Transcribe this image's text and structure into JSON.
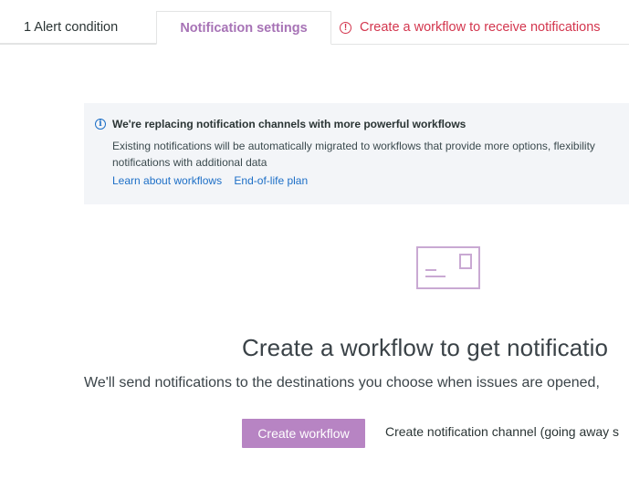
{
  "tabs": {
    "alert_condition": "1 Alert condition",
    "notification_settings": "Notification settings",
    "workflow_warning": "Create a workflow to receive notifications"
  },
  "banner": {
    "title": "We're replacing notification channels with more powerful workflows",
    "body_line1": "Existing notifications will be automatically migrated to workflows that provide more options, flexibility",
    "body_line2": "notifications with additional data",
    "link_learn": "Learn about workflows",
    "link_eol": "End-of-life plan"
  },
  "empty_state": {
    "title": "Create a workflow to get notificatio",
    "subtitle": "We'll send notifications to the destinations you choose when issues are opened,",
    "primary_button": "Create workflow",
    "secondary_button": "Create notification channel (going away s"
  },
  "colors": {
    "accent": "#b784c3",
    "tab_active": "#a773b6",
    "warning": "#d3364e",
    "link": "#1d6fc7",
    "banner_bg": "#f3f5f8"
  },
  "icons": {
    "warning": "warning-circle-icon",
    "info": "info-circle-icon",
    "empty_state": "envelope-icon"
  }
}
